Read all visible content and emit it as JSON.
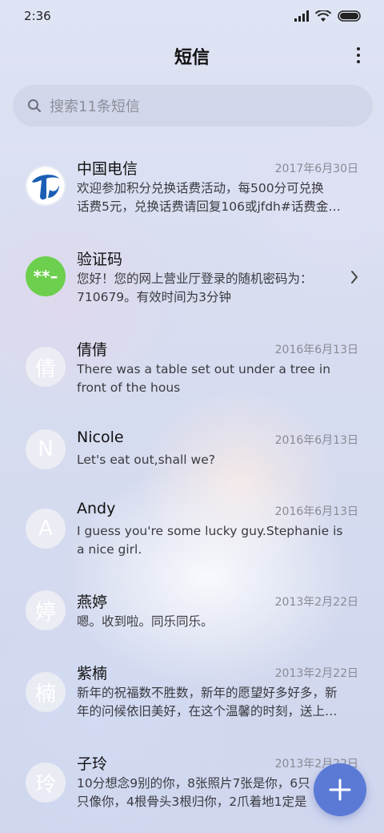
{
  "status_bar": {
    "time": "2:36"
  },
  "header": {
    "title": "短信"
  },
  "search": {
    "placeholder": "搜索11条短信"
  },
  "messages": [
    {
      "name": "中国电信",
      "date": "2017年6月30日",
      "line1": "欢迎参加积分兑换话费活动，每500分可兑换",
      "line2": "话费5元，兑换话费请回复106或jfdh#话费金…",
      "avatar_icon": "china-telecom-logo"
    },
    {
      "name": "验证码",
      "date": "",
      "line1": "您好！您的网上营业厅登录的随机密码为：",
      "line2": "710679。有效时间为3分钟",
      "avatar_text": "**–"
    },
    {
      "name": "倩倩",
      "date": "2016年6月13日",
      "line1": "There was a table set out under a tree in",
      "line2": "front of the hous",
      "avatar_text": "倩"
    },
    {
      "name": "Nicole",
      "date": "2016年6月13日",
      "line1": "Let's eat out,shall we?",
      "line2": "",
      "avatar_text": "N"
    },
    {
      "name": "Andy",
      "date": "2016年6月13日",
      "line1": "I guess you're some lucky guy.Stephanie is",
      "line2": "a nice girl.",
      "avatar_text": "A"
    },
    {
      "name": "燕婷",
      "date": "2013年2月22日",
      "line1": "嗯。收到啦。同乐同乐。",
      "line2": "",
      "avatar_text": "婷"
    },
    {
      "name": "紫楠",
      "date": "2013年2月22日",
      "line1": "新年的祝福数不胜数，新年的愿望好多好多，新",
      "line2": "年的问候依旧美好，在这个温馨的时刻，送上…",
      "avatar_text": "楠"
    },
    {
      "name": "子玲",
      "date": "2013年2月22日",
      "line1": "10分想念9别的你，8张照片7张是你，6只",
      "line2": "只像你，4根骨头3根归你，2爪着地1定是",
      "avatar_text": "玲"
    }
  ],
  "colors": {
    "accent": "#5b7ad6",
    "verify_avatar": "#6ccf4d",
    "telecom_blue": "#1b5fb5"
  },
  "icons": {
    "search": "search-icon",
    "more": "more-vertical-icon",
    "fab": "plus-icon",
    "chevron": "chevron-right-icon"
  }
}
